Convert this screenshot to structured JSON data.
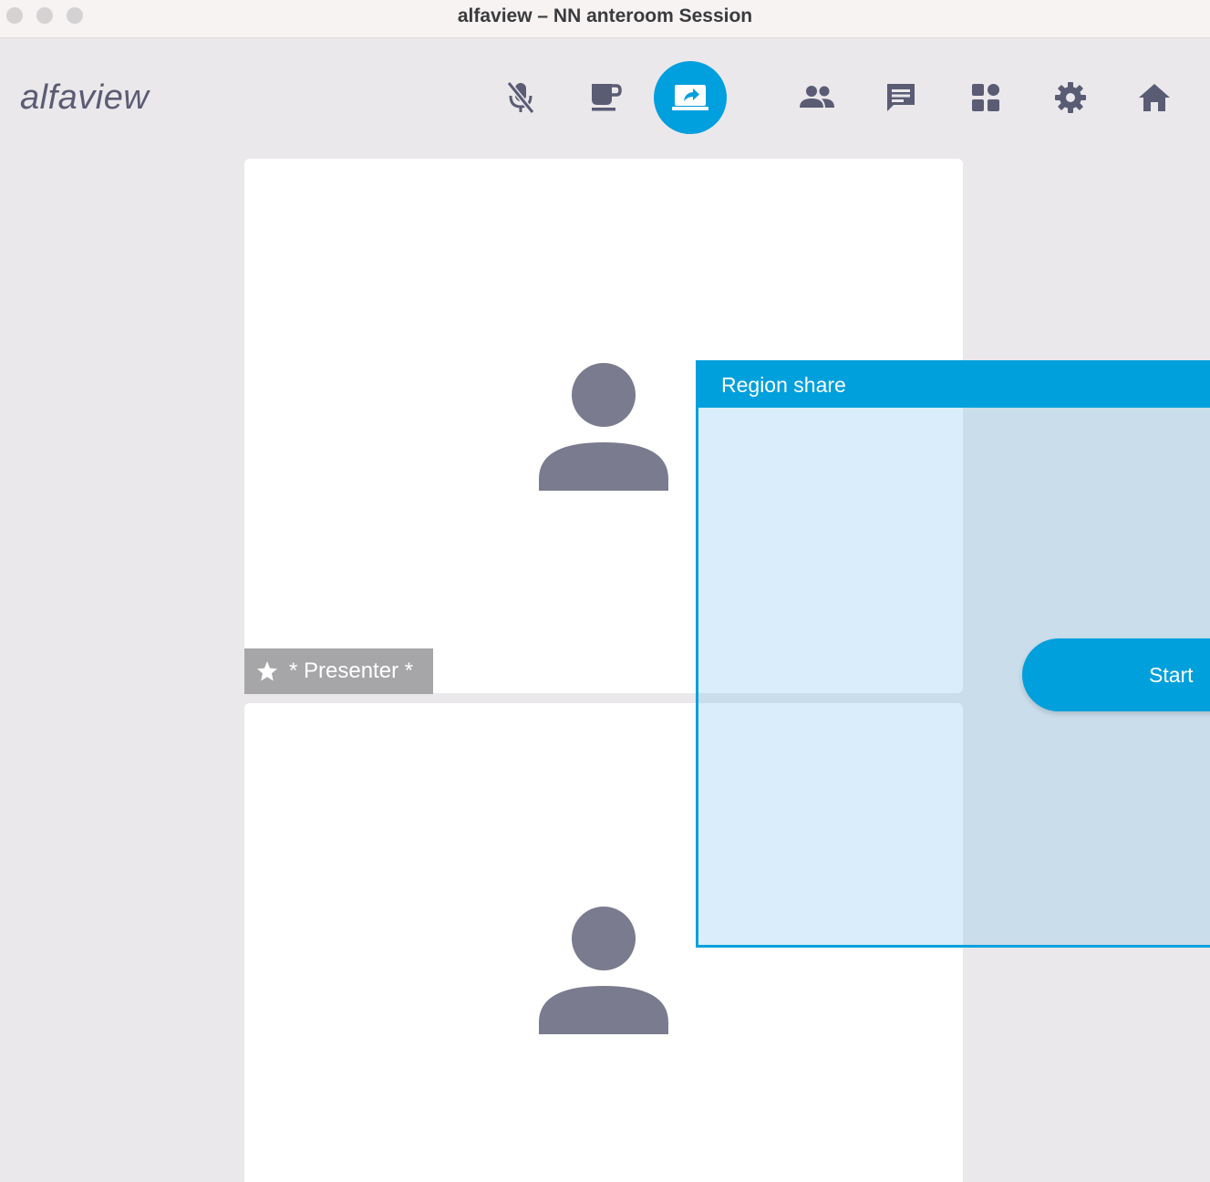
{
  "window": {
    "title": "alfaview – NN anteroom Session"
  },
  "header": {
    "logo_text": "alfaview",
    "toolbar": [
      {
        "name": "mute-microphone",
        "icon": "mic-off-icon",
        "active": false
      },
      {
        "name": "coffee-break",
        "icon": "coffee-icon",
        "active": false
      },
      {
        "name": "screen-share",
        "icon": "screen-share-icon",
        "active": true
      },
      {
        "name": "participants",
        "icon": "people-icon",
        "active": false
      },
      {
        "name": "chat",
        "icon": "chat-icon",
        "active": false
      },
      {
        "name": "layout",
        "icon": "grid-icon",
        "active": false
      },
      {
        "name": "settings",
        "icon": "gear-icon",
        "active": false
      },
      {
        "name": "home",
        "icon": "home-icon",
        "active": false
      }
    ]
  },
  "tiles": {
    "top": {
      "label": "* Presenter *",
      "badge_icon": "star-icon"
    },
    "bottom": {}
  },
  "region_share": {
    "title": "Region share",
    "start_label": "Start"
  },
  "colors": {
    "accent": "#009fde",
    "icon_gray": "#5a5c74",
    "avatar_gray": "#7a7b8e",
    "background": "#ebe8eb"
  }
}
